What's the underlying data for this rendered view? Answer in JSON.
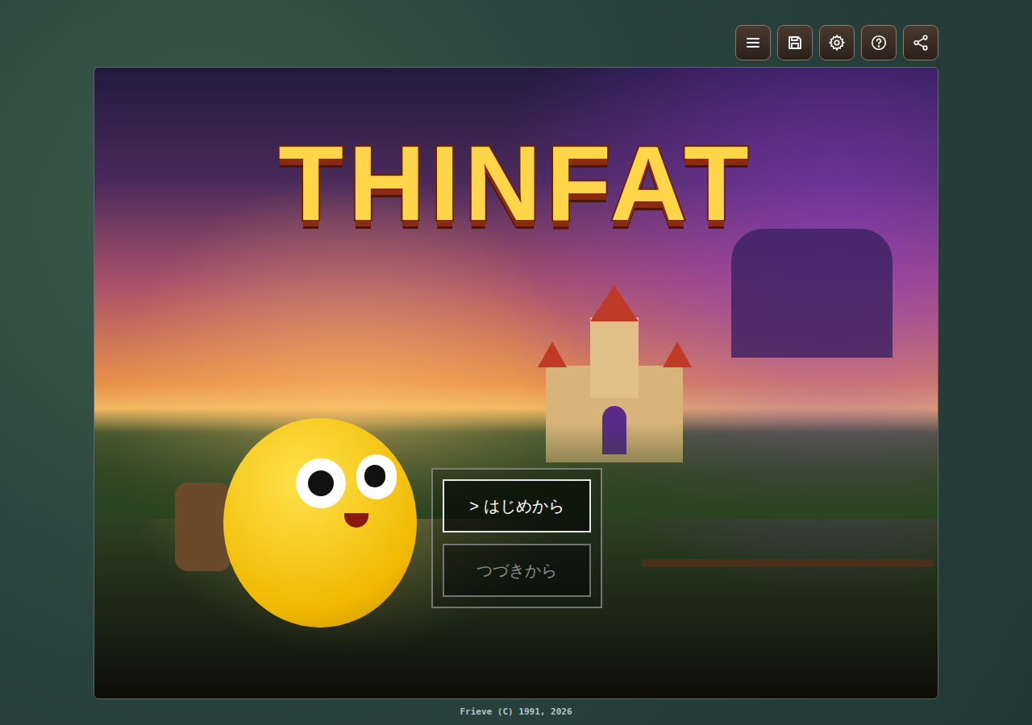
{
  "game": {
    "title": "THINFAT"
  },
  "menu": {
    "cursor": ">",
    "items": [
      {
        "label": "はじめから",
        "selected": true,
        "disabled": false
      },
      {
        "label": "つづきから",
        "selected": false,
        "disabled": true
      }
    ]
  },
  "footer": {
    "copyright": "Frieve (C) 1991, 2026"
  }
}
